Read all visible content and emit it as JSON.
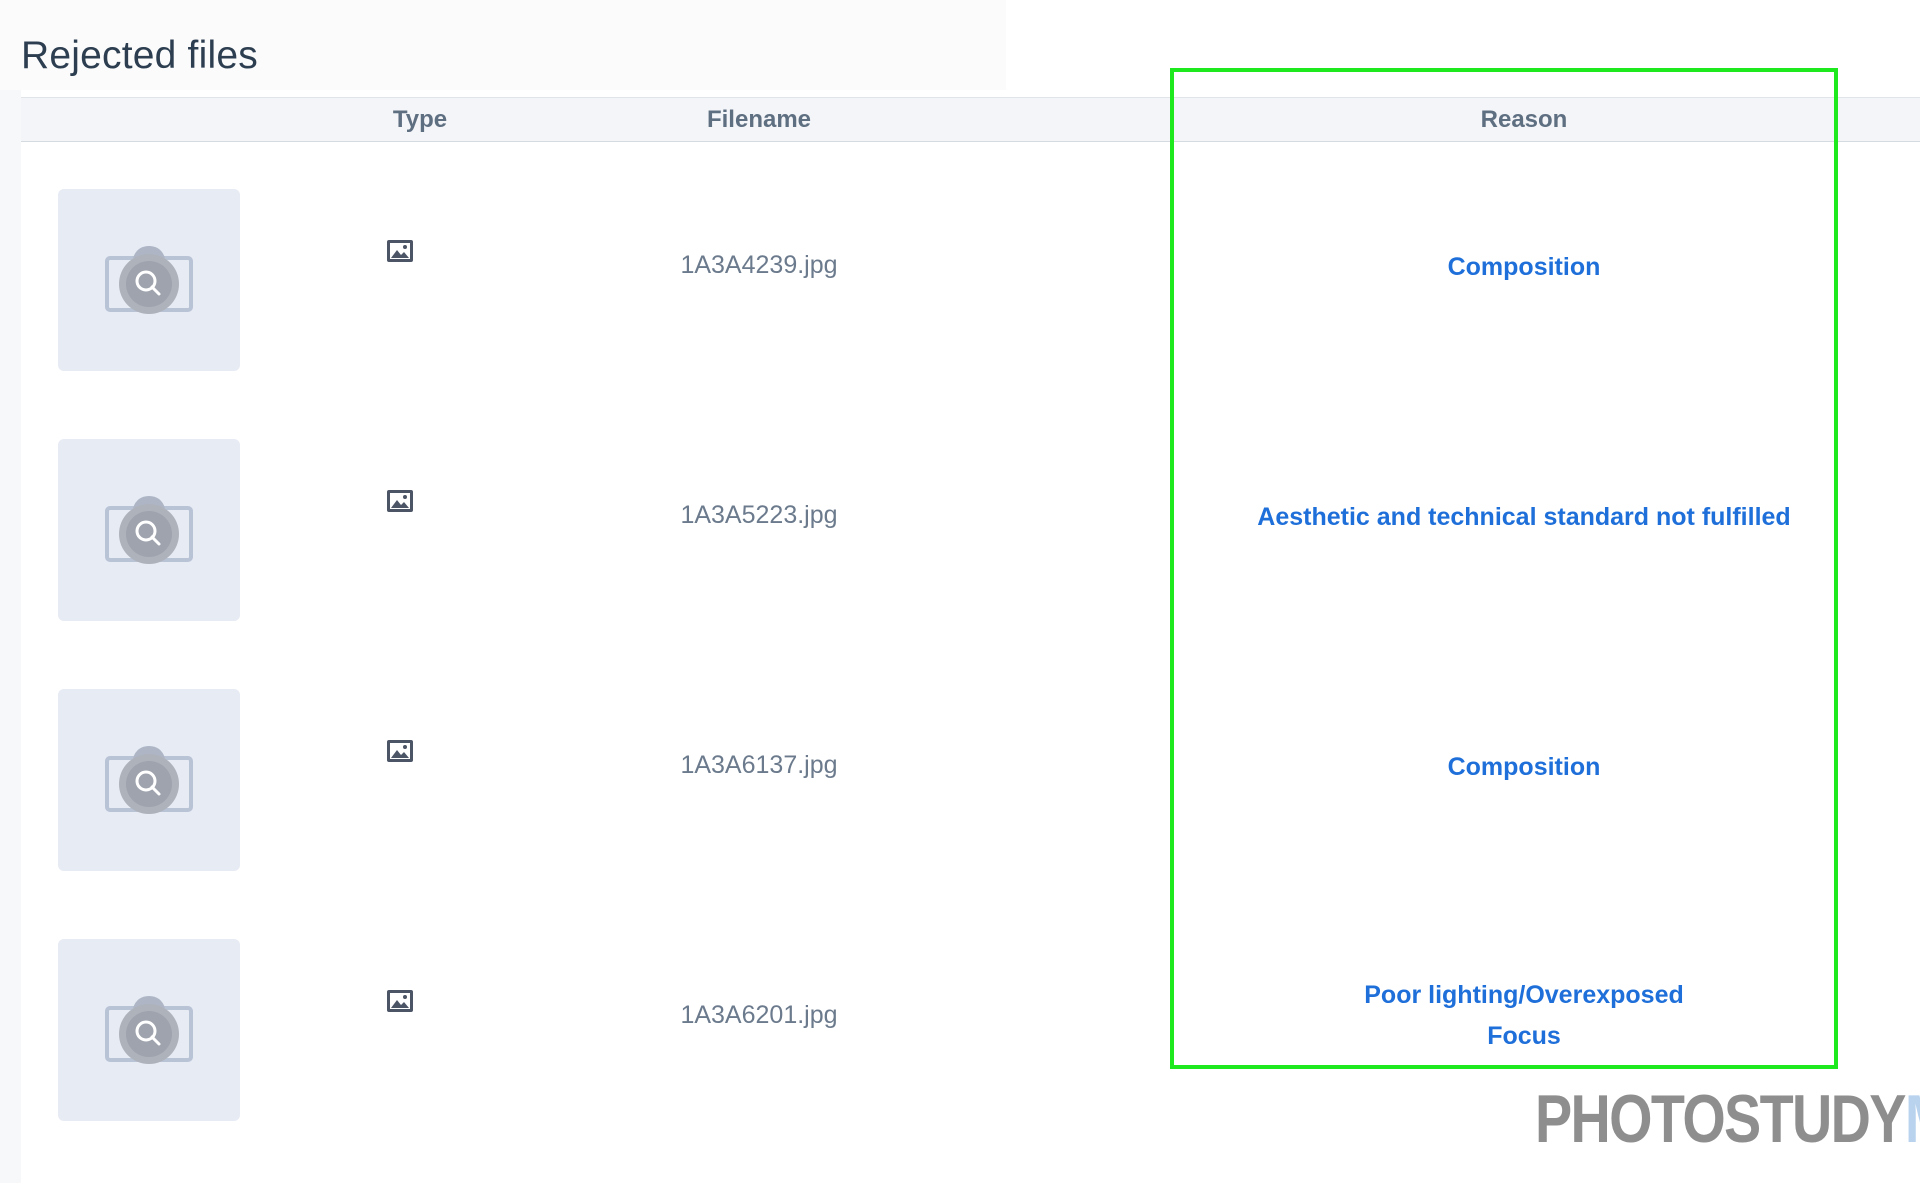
{
  "page": {
    "title": "Rejected files"
  },
  "table": {
    "columns": {
      "thumbnail": "",
      "type": "Type",
      "filename": "Filename",
      "reason": "Reason"
    },
    "rows": [
      {
        "filename": "1A3A4239.jpg",
        "type_icon": "image-icon",
        "reasons": [
          "Composition"
        ]
      },
      {
        "filename": "1A3A5223.jpg",
        "type_icon": "image-icon",
        "reasons": [
          "Aesthetic and technical standard not fulfilled"
        ]
      },
      {
        "filename": "1A3A6137.jpg",
        "type_icon": "image-icon",
        "reasons": [
          "Composition"
        ]
      },
      {
        "filename": "1A3A6201.jpg",
        "type_icon": "image-icon",
        "reasons": [
          "Poor lighting/Overexposed",
          "Focus"
        ]
      }
    ]
  },
  "watermark": {
    "part1": "PHOTOSTUDY",
    "part2": "ME"
  },
  "colors": {
    "reason_link": "#1e6fd9",
    "highlight": "#1ee81e",
    "header_bg": "#f3f5f8"
  }
}
